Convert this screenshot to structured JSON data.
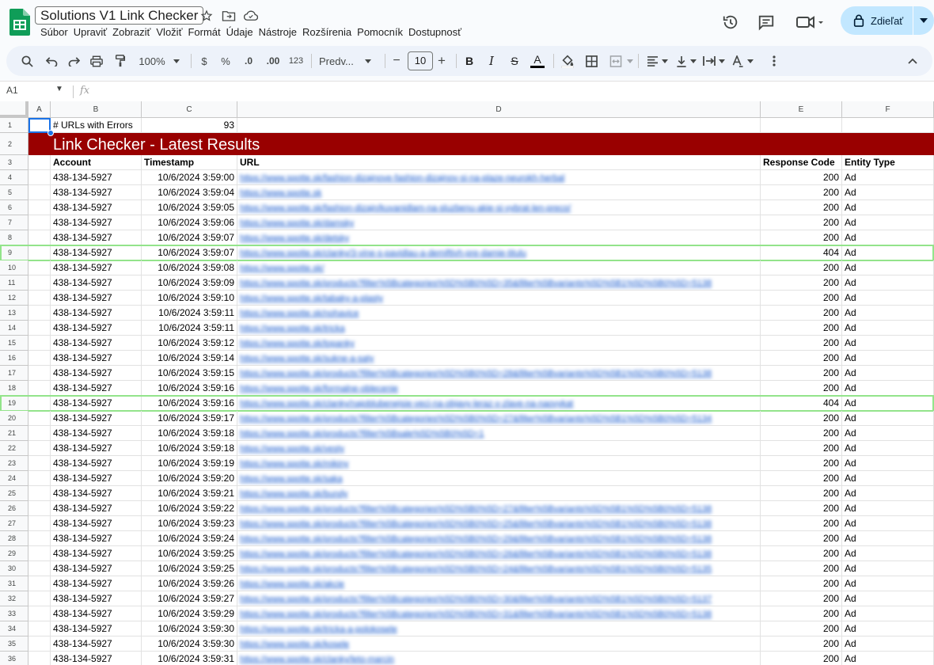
{
  "app": {
    "title": "Solutions V1 Link Checker",
    "menu": [
      "Súbor",
      "Upraviť",
      "Zobraziť",
      "Vložiť",
      "Formát",
      "Údaje",
      "Nástroje",
      "Rozšírenia",
      "Pomocník",
      "Dostupnosť"
    ],
    "share_label": "Zdieľať"
  },
  "toolbar": {
    "zoom": "100%",
    "currency": "$",
    "percent": "%",
    "dec_decrease": ".0",
    "dec_increase": ".00",
    "number_format": "123",
    "font": "Predv...",
    "font_size": "10",
    "minus": "−",
    "plus": "+",
    "bold": "B",
    "italic": "I",
    "strike": "S",
    "textcolor": "A"
  },
  "formula_bar": {
    "cell_ref": "A1",
    "fx": "fx"
  },
  "columns": [
    "A",
    "B",
    "C",
    "D",
    "E",
    "F"
  ],
  "sheet": {
    "errors_label": "# URLs with Errors",
    "errors_count": "93",
    "banner": "Link Checker - Latest Results",
    "headers": [
      "Account",
      "Timestamp",
      "URL",
      "Response Code",
      "Entity Type"
    ],
    "rows": [
      {
        "n": "4",
        "account": "438-134-5927",
        "ts": "10/6/2024 3:59:00",
        "url": "https://www.spotte.sk/fashion-dizajnove-fashion-dizajnov-si-na-plaze-neurokh-herbal",
        "code": "200",
        "type": "Ad"
      },
      {
        "n": "5",
        "account": "438-134-5927",
        "ts": "10/6/2024 3:59:04",
        "url": "https://www.spotte.sk",
        "code": "200",
        "type": "Ad"
      },
      {
        "n": "6",
        "account": "438-134-5927",
        "ts": "10/6/2024 3:59:05",
        "url": "https://www.spotte.sk/fashion-dizajn/kuvanidlam-na-sluzbenu-akie-si-vybrat-len-preco/",
        "code": "200",
        "type": "Ad"
      },
      {
        "n": "7",
        "account": "438-134-5927",
        "ts": "10/6/2024 3:59:06",
        "url": "https://www.spotte.sk/damsky",
        "code": "200",
        "type": "Ad"
      },
      {
        "n": "8",
        "account": "438-134-5927",
        "ts": "10/6/2024 3:59:07",
        "url": "https://www.spotte.sk/detsky",
        "code": "200",
        "type": "Ad"
      },
      {
        "n": "9",
        "account": "438-134-5927",
        "ts": "10/6/2024 3:59:07",
        "url": "https://www.spotte.sk/clanky/3-vine-s-pavidlau-a-demiftivh-pre-damie-titulu",
        "code": "404",
        "type": "Ad",
        "error": true
      },
      {
        "n": "10",
        "account": "438-134-5927",
        "ts": "10/6/2024 3:59:08",
        "url": "https://www.spotte.sk/",
        "code": "200",
        "type": "Ad"
      },
      {
        "n": "11",
        "account": "438-134-5927",
        "ts": "10/6/2024 3:59:09",
        "url": "https://www.spotte.sk/products?filter%5Bcategories%5D%5B0%5D=35&filter%5Bvariants%5D%5B1%5D%5B0%5D=5138",
        "code": "200",
        "type": "Ad"
      },
      {
        "n": "12",
        "account": "438-134-5927",
        "ts": "10/6/2024 3:59:10",
        "url": "https://www.spotte.sk/tabaky-a-plasty",
        "code": "200",
        "type": "Ad"
      },
      {
        "n": "13",
        "account": "438-134-5927",
        "ts": "10/6/2024 3:59:11",
        "url": "https://www.spotte.sk/nohavice",
        "code": "200",
        "type": "Ad"
      },
      {
        "n": "14",
        "account": "438-134-5927",
        "ts": "10/6/2024 3:59:11",
        "url": "https://www.spotte.sk/tricka",
        "code": "200",
        "type": "Ad"
      },
      {
        "n": "15",
        "account": "438-134-5927",
        "ts": "10/6/2024 3:59:12",
        "url": "https://www.spotte.sk/topanky",
        "code": "200",
        "type": "Ad"
      },
      {
        "n": "16",
        "account": "438-134-5927",
        "ts": "10/6/2024 3:59:14",
        "url": "https://www.spotte.sk/sukne-a-saty",
        "code": "200",
        "type": "Ad"
      },
      {
        "n": "17",
        "account": "438-134-5927",
        "ts": "10/6/2024 3:59:15",
        "url": "https://www.spotte.sk/products?filter%5Bcategories%5D%5B0%5D=28&filter%5Bvariants%5D%5B1%5D%5B0%5D=5138",
        "code": "200",
        "type": "Ad"
      },
      {
        "n": "18",
        "account": "438-134-5927",
        "ts": "10/6/2024 3:59:16",
        "url": "https://www.spotte.sk/formalne-oblecenie",
        "code": "200",
        "type": "Ad"
      },
      {
        "n": "19",
        "account": "438-134-5927",
        "ts": "10/6/2024 3:59:16",
        "url": "https://www.spotte.sk/clanky/najoblubenejsie-veci-na-objavy-leraz-v-zlave-na-naovykat",
        "code": "404",
        "type": "Ad",
        "error": true
      },
      {
        "n": "20",
        "account": "438-134-5927",
        "ts": "10/6/2024 3:59:17",
        "url": "https://www.spotte.sk/products?filter%5Bcategories%5D%5B0%5D=27&filter%5Bvariants%5D%5B1%5D%5B0%5D=5134",
        "code": "200",
        "type": "Ad"
      },
      {
        "n": "21",
        "account": "438-134-5927",
        "ts": "10/6/2024 3:59:18",
        "url": "https://www.spotte.sk/products?filter%5Bsale%5D%5B0%5D=1",
        "code": "200",
        "type": "Ad"
      },
      {
        "n": "22",
        "account": "438-134-5927",
        "ts": "10/6/2024 3:59:18",
        "url": "https://www.spotte.sk/vesty",
        "code": "200",
        "type": "Ad"
      },
      {
        "n": "23",
        "account": "438-134-5927",
        "ts": "10/6/2024 3:59:19",
        "url": "https://www.spotte.sk/mikiny",
        "code": "200",
        "type": "Ad"
      },
      {
        "n": "24",
        "account": "438-134-5927",
        "ts": "10/6/2024 3:59:20",
        "url": "https://www.spotte.sk/saka",
        "code": "200",
        "type": "Ad"
      },
      {
        "n": "25",
        "account": "438-134-5927",
        "ts": "10/6/2024 3:59:21",
        "url": "https://www.spotte.sk/bundy",
        "code": "200",
        "type": "Ad"
      },
      {
        "n": "26",
        "account": "438-134-5927",
        "ts": "10/6/2024 3:59:22",
        "url": "https://www.spotte.sk/products?filter%5Bcategories%5D%5B0%5D=27&filter%5Bvariants%5D%5B1%5D%5B0%5D=5138",
        "code": "200",
        "type": "Ad"
      },
      {
        "n": "27",
        "account": "438-134-5927",
        "ts": "10/6/2024 3:59:23",
        "url": "https://www.spotte.sk/products?filter%5Bcategories%5D%5B0%5D=25&filter%5Bvariants%5D%5B1%5D%5B0%5D=5138",
        "code": "200",
        "type": "Ad"
      },
      {
        "n": "28",
        "account": "438-134-5927",
        "ts": "10/6/2024 3:59:24",
        "url": "https://www.spotte.sk/products?filter%5Bcategories%5D%5B0%5D=29&filter%5Bvariants%5D%5B1%5D%5B0%5D=5138",
        "code": "200",
        "type": "Ad"
      },
      {
        "n": "29",
        "account": "438-134-5927",
        "ts": "10/6/2024 3:59:25",
        "url": "https://www.spotte.sk/products?filter%5Bcategories%5D%5B0%5D=26&filter%5Bvariants%5D%5B1%5D%5B0%5D=5138",
        "code": "200",
        "type": "Ad"
      },
      {
        "n": "30",
        "account": "438-134-5927",
        "ts": "10/6/2024 3:59:25",
        "url": "https://www.spotte.sk/products?filter%5Bcategories%5D%5B0%5D=24&filter%5Bvariants%5D%5B1%5D%5B0%5D=5135",
        "code": "200",
        "type": "Ad"
      },
      {
        "n": "31",
        "account": "438-134-5927",
        "ts": "10/6/2024 3:59:26",
        "url": "https://www.spotte.sk/akcie",
        "code": "200",
        "type": "Ad"
      },
      {
        "n": "32",
        "account": "438-134-5927",
        "ts": "10/6/2024 3:59:27",
        "url": "https://www.spotte.sk/products?filter%5Bcategories%5D%5B0%5D=30&filter%5Bvariants%5D%5B1%5D%5B0%5D=5137",
        "code": "200",
        "type": "Ad"
      },
      {
        "n": "33",
        "account": "438-134-5927",
        "ts": "10/6/2024 3:59:29",
        "url": "https://www.spotte.sk/products?filter%5Bcategories%5D%5B0%5D=31&filter%5Bvariants%5D%5B1%5D%5B0%5D=5138",
        "code": "200",
        "type": "Ad"
      },
      {
        "n": "34",
        "account": "438-134-5927",
        "ts": "10/6/2024 3:59:30",
        "url": "https://www.spotte.sk/tricka-a-polokosele",
        "code": "200",
        "type": "Ad"
      },
      {
        "n": "35",
        "account": "438-134-5927",
        "ts": "10/6/2024 3:59:30",
        "url": "https://www.spotte.sk/kosele",
        "code": "200",
        "type": "Ad"
      },
      {
        "n": "36",
        "account": "438-134-5927",
        "ts": "10/6/2024 3:59:31",
        "url": "https://www.spotte.sk/clanky/leto-marcin",
        "code": "200",
        "type": "Ad"
      }
    ]
  },
  "colors": {
    "banner": "#990000",
    "highlight": "#93e48b",
    "share": "#c2e7ff",
    "link": "#1155cc"
  }
}
